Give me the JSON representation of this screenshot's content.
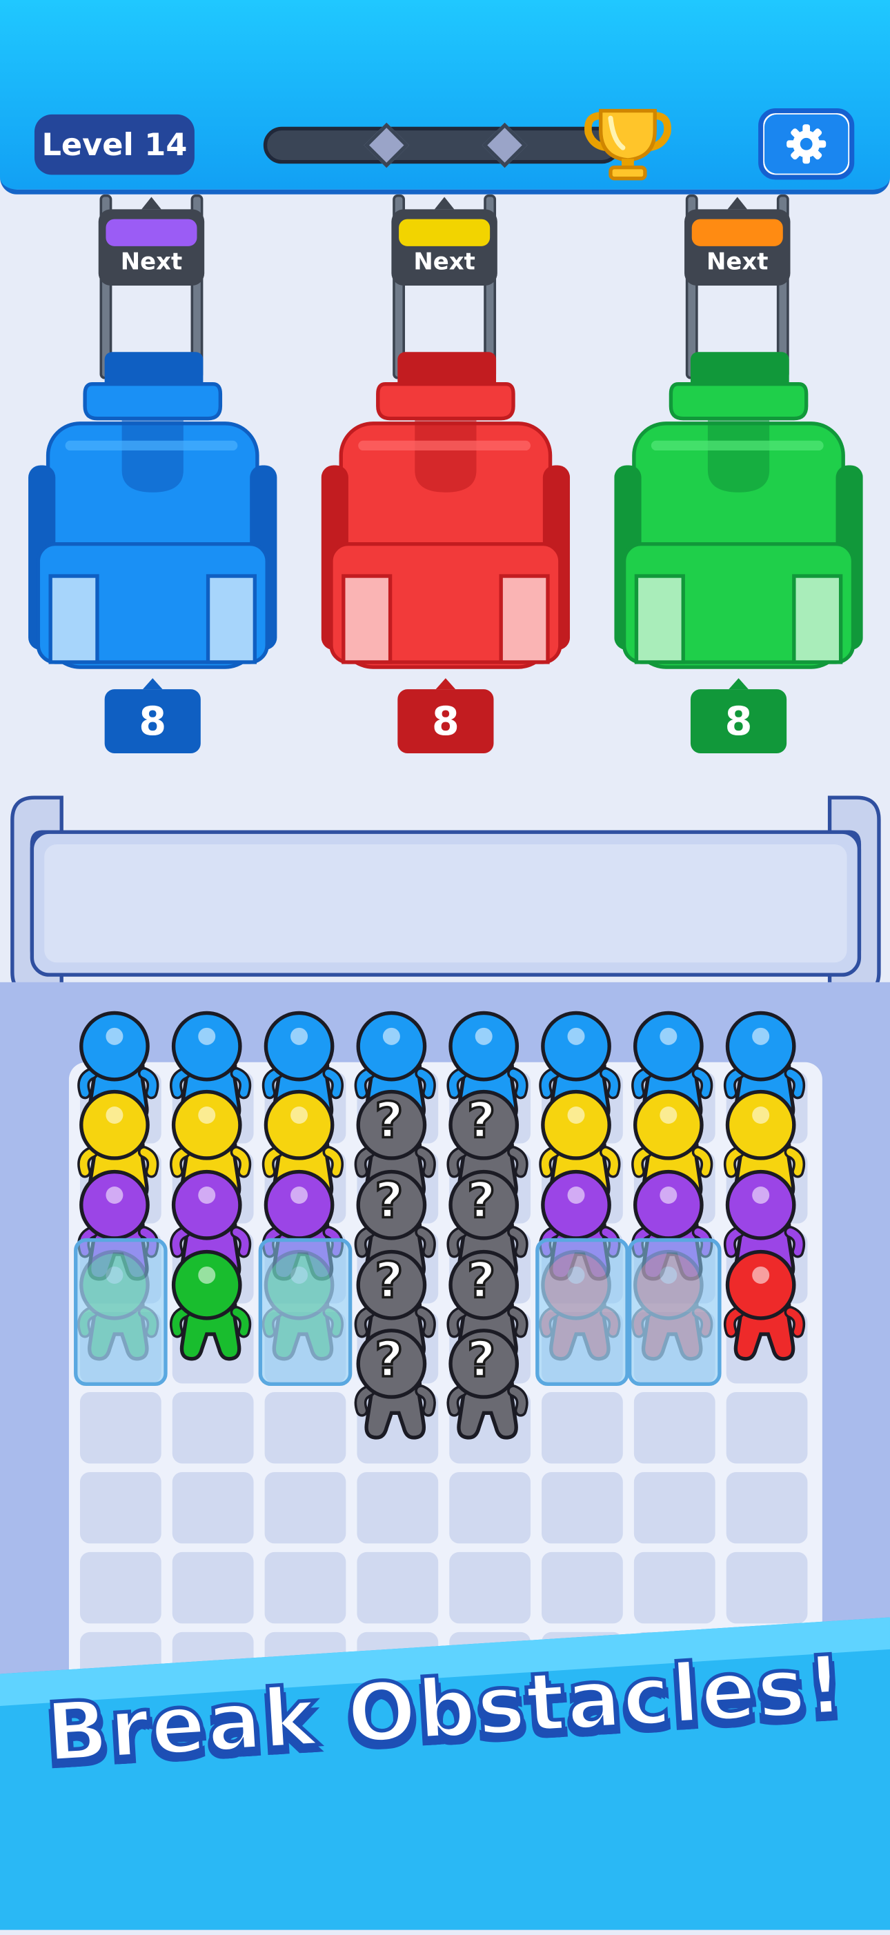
{
  "header": {
    "level_label": "Level 14",
    "progress_icon": "trophy-icon",
    "settings_icon": "gear-icon",
    "milestones_total": 2
  },
  "machines": [
    {
      "name": "blue-machine",
      "color": "#1a90f5",
      "dark": "#0f5fc2",
      "light": "#4ab0ff",
      "count": "8",
      "next_label": "Next",
      "next_color": "#9b5cf5"
    },
    {
      "name": "red-machine",
      "color": "#f23a3a",
      "dark": "#c21c20",
      "light": "#ff6a6a",
      "count": "8",
      "next_label": "Next",
      "next_color": "#f2d400"
    },
    {
      "name": "green-machine",
      "color": "#1fcf4a",
      "dark": "#11983a",
      "light": "#52e777",
      "count": "8",
      "next_label": "Next",
      "next_color": "#ff8b12"
    }
  ],
  "colors": {
    "blue": "#1b9af5",
    "yellow": "#f6d40f",
    "purple": "#9b45e6",
    "green": "#19bd2e",
    "red": "#ee2a2a",
    "gray": "#5e5e66",
    "ice": "#9fd6f5"
  },
  "grid": {
    "columns": 8,
    "rows": 8,
    "people": [
      [
        "blue",
        "yellow",
        "purple",
        "ice-green"
      ],
      [
        "blue",
        "yellow",
        "purple",
        "green"
      ],
      [
        "blue",
        "yellow",
        "purple",
        "ice-green"
      ],
      [
        "blue",
        "mystery",
        "mystery",
        "mystery",
        "mystery"
      ],
      [
        "blue",
        "mystery",
        "mystery",
        "mystery",
        "mystery"
      ],
      [
        "blue",
        "yellow",
        "purple",
        "ice-red"
      ],
      [
        "blue",
        "yellow",
        "purple",
        "ice-red"
      ],
      [
        "blue",
        "yellow",
        "purple",
        "red"
      ]
    ],
    "mystery_label": "?"
  },
  "banner": {
    "text": "Break Obstacles!"
  }
}
